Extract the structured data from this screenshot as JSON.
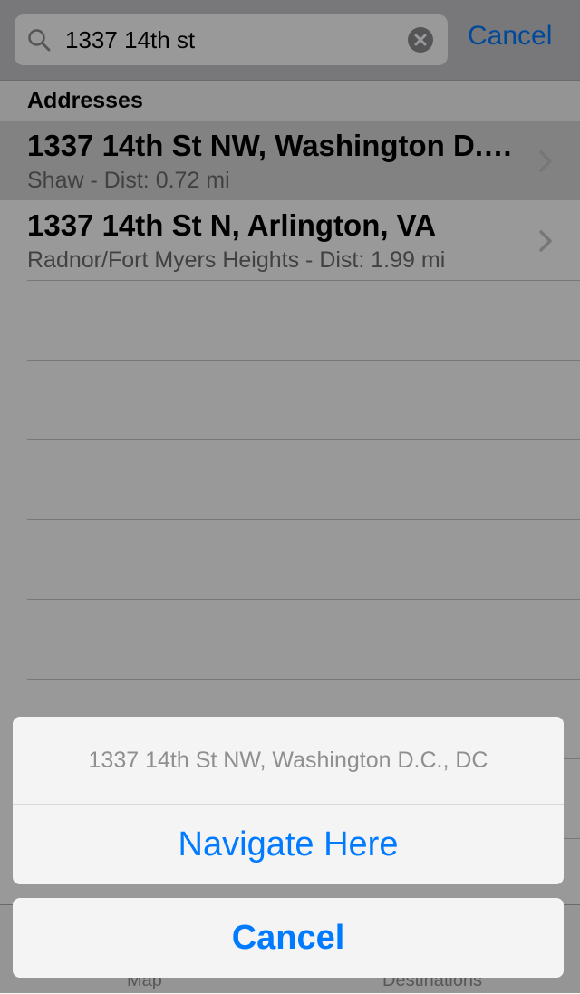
{
  "search": {
    "query": "1337 14th st",
    "cancel_label": "Cancel"
  },
  "section": {
    "title": "Addresses"
  },
  "results": [
    {
      "title": "1337 14th St NW, Washington D.C., DC",
      "subtitle": "Shaw - Dist: 0.72 mi"
    },
    {
      "title": "1337 14th St N, Arlington, VA",
      "subtitle": "Radnor/Fort Myers Heights - Dist: 1.99 mi"
    }
  ],
  "tabs": [
    {
      "label": "Map"
    },
    {
      "label": "Destinations"
    }
  ],
  "action_sheet": {
    "title": "1337 14th St NW, Washington D.C., DC",
    "action_label": "Navigate Here",
    "cancel_label": "Cancel"
  },
  "colors": {
    "accent": "#007aff",
    "search_bar_bg": "#c9c9ce",
    "selected_row_bg": "#d9d9d9"
  },
  "icons": {
    "search": "magnifying-glass",
    "clear": "clear-x-circle",
    "disclosure": "chevron-right"
  }
}
